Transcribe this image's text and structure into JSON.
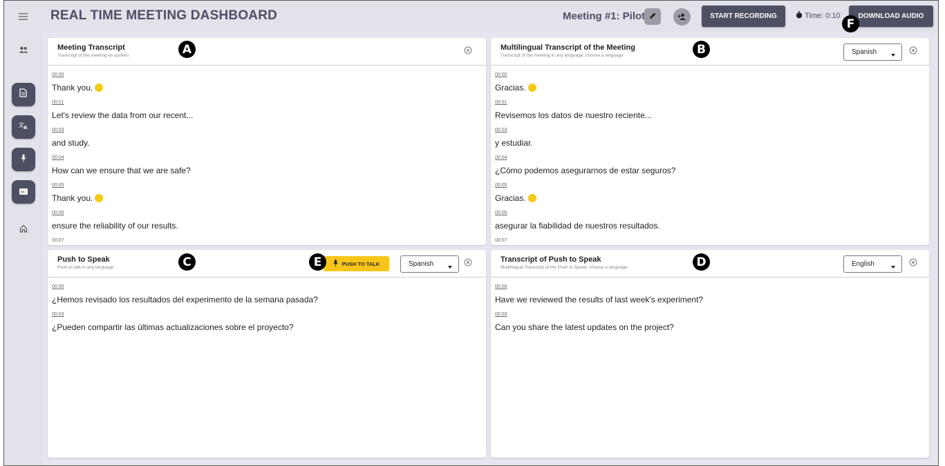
{
  "header": {
    "title": "REAL TIME MEETING DASHBOARD",
    "meeting_name": "Meeting #1: Pilot",
    "record_label": "START RECORDING",
    "timer": "Time: 0:10",
    "download_label": "DOWNLOAD AUDIO"
  },
  "sidebar": {
    "items": [
      "menu",
      "people",
      "document",
      "translate",
      "microphone",
      "captions",
      "home"
    ]
  },
  "markers": {
    "a": "A",
    "b": "B",
    "c": "C",
    "d": "D",
    "e": "E",
    "f": "F"
  },
  "panel_a": {
    "title": "Meeting Transcript",
    "subtitle": "Transcript of the meeting as spoken",
    "entries": [
      {
        "time": "00:00",
        "text": "Thank you."
      },
      {
        "time": "00:01",
        "text": "Let's review the data from our recent..."
      },
      {
        "time": "00:03",
        "text": "and study."
      },
      {
        "time": "00:04",
        "text": "How can we ensure that we are safe?"
      },
      {
        "time": "00:05",
        "text": "Thank you."
      },
      {
        "time": "00:05",
        "text": "ensure the reliability of our results."
      },
      {
        "time": "00:07",
        "text": ""
      }
    ]
  },
  "panel_b": {
    "title": "Multilingual Transcript of the Meeting",
    "subtitle": "Transcript of the meeting in any language, choose a language",
    "language": "Spanish",
    "entries": [
      {
        "time": "00:00",
        "text": "Gracias."
      },
      {
        "time": "00:01",
        "text": "Revisemos los datos de nuestro reciente..."
      },
      {
        "time": "00:03",
        "text": "y estudiar."
      },
      {
        "time": "00:04",
        "text": "¿Cómo podemos asegurarnos de estar seguros?"
      },
      {
        "time": "00:05",
        "text": "Gracias."
      },
      {
        "time": "00:05",
        "text": "asegurar la fiabilidad de nuestros resultados."
      },
      {
        "time": "00:07",
        "text": ""
      }
    ]
  },
  "panel_c": {
    "title": "Push to Speak",
    "subtitle": "Push to talk in any language",
    "push_label": "PUSH TO TALK",
    "language": "Spanish",
    "entries": [
      {
        "time": "00:00",
        "text": "¿Hemos revisado los resultados del experimento de la semana pasada?"
      },
      {
        "time": "00:03",
        "text": "¿Pueden compartir las últimas actualizaciones sobre el proyecto?"
      }
    ]
  },
  "panel_d": {
    "title": "Transcript of Push to Speak",
    "subtitle": "Multilingual Transcript of the Push to Speak, choose a language",
    "language": "English",
    "entries": [
      {
        "time": "00:00",
        "text": "Have we reviewed the results of last week's experiment?"
      },
      {
        "time": "00:03",
        "text": "Can you share the latest updates on the project?"
      }
    ]
  },
  "colors": {
    "accent": "#4d4f63",
    "push_to_talk": "#f7c619",
    "background": "#e6e6ef"
  }
}
